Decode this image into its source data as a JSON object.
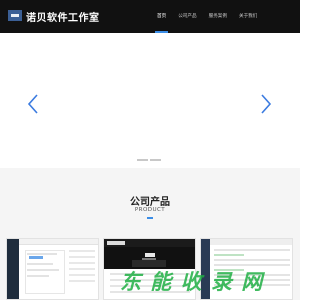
{
  "header": {
    "brand": "诺贝软件工作室",
    "logo_icon": "logo-icon",
    "nav": [
      {
        "label": "首页",
        "active": true
      },
      {
        "label": "公司产品",
        "active": false
      },
      {
        "label": "服务案例",
        "active": false
      },
      {
        "label": "关于我们",
        "active": false
      }
    ]
  },
  "banner": {
    "prev_icon": "chevron-left-icon",
    "next_icon": "chevron-right-icon",
    "slide_count": 2
  },
  "products": {
    "title": "公司产品",
    "subtitle": "PRODUCT"
  },
  "watermark": "东 能 收 录 网",
  "colors": {
    "header_bg": "#111111",
    "accent": "#3b8de6",
    "arrow": "#3b7be0",
    "watermark": "#20b045"
  }
}
